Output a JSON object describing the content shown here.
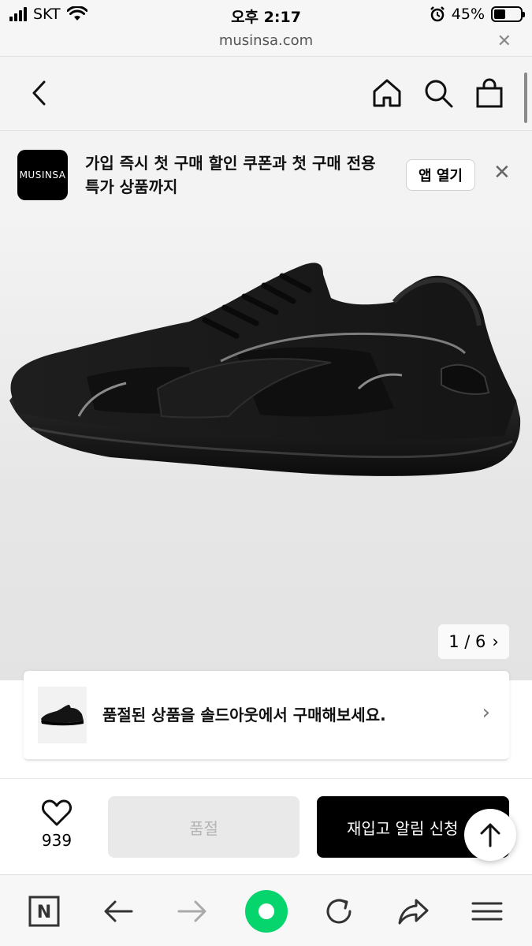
{
  "status_bar": {
    "carrier": "SKT",
    "time": "오후 2:17",
    "battery_percent": "45%",
    "battery_level": 0.45,
    "icons": [
      "signal-icon",
      "wifi-icon",
      "alarm-icon",
      "battery-icon"
    ]
  },
  "url_bar": {
    "url": "musinsa.com",
    "close": "✕"
  },
  "header": {
    "icons": [
      "back-icon",
      "home-icon",
      "search-icon",
      "shopping-bag-icon"
    ]
  },
  "banner": {
    "logo_text": "MUSINSA",
    "message": "가입 즉시 첫 구매 할인 쿠폰과 첫 구매 전용 특가 상품까지",
    "open_app_label": "앱 열기",
    "close": "✕"
  },
  "gallery": {
    "current": "1",
    "separator": "/",
    "total": "6",
    "counter_text": "1 / 6",
    "chevron": "›"
  },
  "soldout_card": {
    "message": "품절된 상품을 솔드아웃에서 구매해보세요.",
    "chevron": "›"
  },
  "action_bar": {
    "like_count": "939",
    "soldout_label": "품절",
    "restock_label": "재입고 알림 신청"
  },
  "browser_toolbar": {
    "icons": [
      "naver-n-icon",
      "back-arrow-icon",
      "forward-arrow-icon",
      "green-dot-icon",
      "refresh-icon",
      "share-icon",
      "menu-icon"
    ],
    "n_label": "N"
  },
  "colors": {
    "accent_green": "#06d46c",
    "primary_button": "#000000",
    "disabled_button": "#e9e9e9"
  }
}
